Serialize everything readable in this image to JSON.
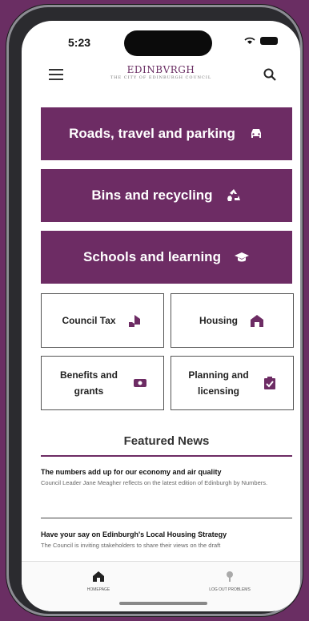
{
  "status": {
    "time": "5:23"
  },
  "header": {
    "logo": "EDINBVRGH",
    "logo_sub": "THE CITY OF EDINBURGH COUNCIL"
  },
  "main_buttons": [
    {
      "label": "Roads, travel and parking",
      "icon": "car-icon"
    },
    {
      "label": "Bins and recycling",
      "icon": "recycle-icon"
    },
    {
      "label": "Schools and learning",
      "icon": "graduation-cap-icon"
    }
  ],
  "tiles": [
    {
      "label": "Council Tax",
      "icon": "hand-house-icon"
    },
    {
      "label": "Housing",
      "icon": "house-icon"
    },
    {
      "label": "Benefits and grants",
      "icon": "money-icon"
    },
    {
      "label": "Planning and licensing",
      "icon": "clipboard-icon"
    }
  ],
  "featured": {
    "title": "Featured News",
    "items": [
      {
        "headline": "The numbers add up for our economy and air quality",
        "body": "Council Leader Jane Meagher reflects on the latest edition of Edinburgh by Numbers."
      },
      {
        "headline": "Have your say on Edinburgh's Local Housing Strategy",
        "body": "The Council is inviting stakeholders to share their views on the draft"
      }
    ]
  },
  "tabbar": {
    "home": "HOMEPAGE",
    "report": "LOG OUT PROBLEMS"
  },
  "colors": {
    "brand": "#6d2c64",
    "background": "#6a2e63"
  }
}
